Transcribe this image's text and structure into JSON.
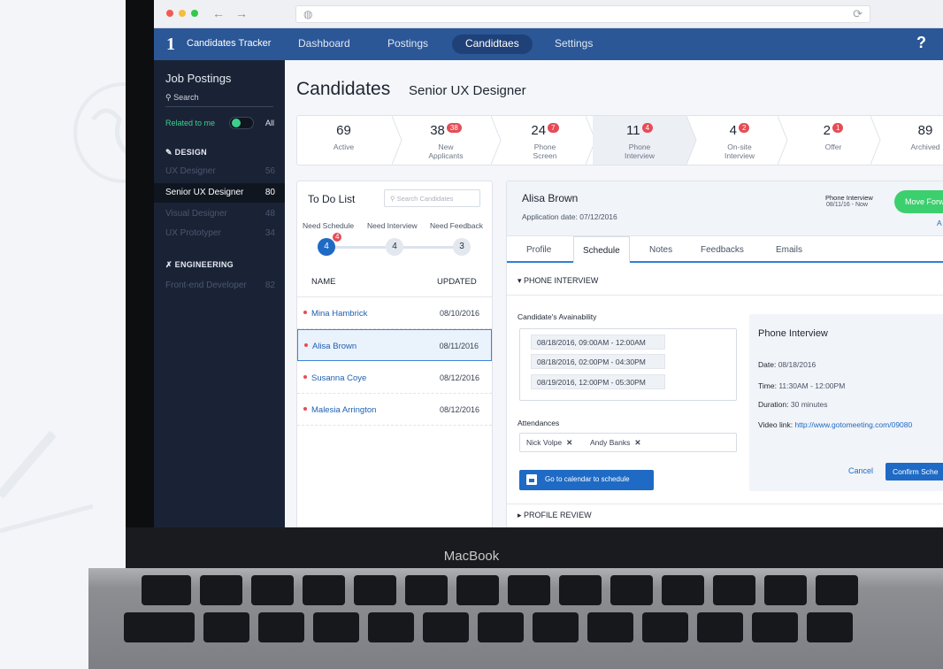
{
  "device": {
    "brand": "MacBook"
  },
  "browser": {
    "url": "",
    "nav_back": "←",
    "nav_forward": "→",
    "reload_glyph": "⟳",
    "globe_glyph": "◍"
  },
  "app": {
    "logo": "1",
    "title": "Candidates Tracker",
    "help": "?"
  },
  "topnav": {
    "items": [
      "Dashboard",
      "Postings",
      "Candidtaes",
      "Settings"
    ],
    "active": "Candidtaes"
  },
  "sidebar": {
    "title": "Job Postings",
    "search_placeholder": "Search",
    "related_label": "Related to me",
    "all_label": "All",
    "sections": [
      {
        "name": "DESIGN",
        "icon": "tools-icon",
        "items": [
          {
            "label": "UX Designer",
            "count": "56"
          },
          {
            "label": "Senior UX Designer",
            "count": "80",
            "active": true
          },
          {
            "label": "Visual Designer",
            "count": "48"
          },
          {
            "label": "UX Prototyper",
            "count": "34"
          }
        ]
      },
      {
        "name": "ENGINEERING",
        "icon": "engineering-icon",
        "items": [
          {
            "label": "Front-end Developer",
            "count": "82"
          }
        ]
      }
    ]
  },
  "page": {
    "title": "Candidates",
    "subtitle": "Senior UX Designer"
  },
  "pipeline": [
    {
      "count": "69",
      "label": "Active",
      "badge": ""
    },
    {
      "count": "38",
      "label": "New Applicants",
      "badge": "38"
    },
    {
      "count": "24",
      "label": "Phone Screen",
      "badge": "7"
    },
    {
      "count": "11",
      "label": "Phone Interview",
      "badge": "4"
    },
    {
      "count": "4",
      "label": "On-site Interview",
      "badge": "2"
    },
    {
      "count": "2",
      "label": "Offer",
      "badge": "1"
    },
    {
      "count": "89",
      "label": "Archived",
      "badge": ""
    }
  ],
  "todo": {
    "title": "To Do List",
    "search_placeholder": "Search Candidates",
    "steps": [
      {
        "label": "Need Schedule",
        "count": "4",
        "badge": "4"
      },
      {
        "label": "Need Interview",
        "count": "4"
      },
      {
        "label": "Need Feedback",
        "count": "3"
      }
    ],
    "columns": {
      "name": "NAME",
      "updated": "UPDATED"
    },
    "rows": [
      {
        "name": "Mina Hambrick",
        "updated": "08/10/2016"
      },
      {
        "name": "Alisa Brown",
        "updated": "08/11/2016",
        "selected": true
      },
      {
        "name": "Susanna Coye",
        "updated": "08/12/2016"
      },
      {
        "name": "Malesia Arrington",
        "updated": "08/12/2016"
      }
    ]
  },
  "detail": {
    "name": "Alisa Brown",
    "application_date": "Application date:  07/12/2016",
    "stage": "Phone Interview",
    "stage_date": "08/11/16 - Now",
    "move_button": "Move Forw",
    "side_link": "A",
    "tabs": [
      "Profile",
      "Schedule",
      "Notes",
      "Feedbacks",
      "Emails"
    ],
    "active_tab": "Schedule",
    "section_phone": "PHONE INTERVIEW",
    "availability_label": "Candidate's Avainability",
    "slots": [
      "08/18/2016, 09:00AM - 12:00AM",
      "08/18/2016, 02:00PM - 04:30PM",
      "08/19/2016, 12:00PM - 05:30PM"
    ],
    "attendances_label": "Attendances",
    "attendees": [
      "Nick Volpe",
      "Andy Banks"
    ],
    "remove_glyph": "✕",
    "calendar_button": "Go to calendar to schedule",
    "section_profile": "PROFILE REVIEW",
    "interview": {
      "title": "Phone Interview",
      "date_label": "Date:",
      "date": "08/18/2016",
      "time_label": "Time:",
      "time": "11:30AM - 12:00PM",
      "duration_label": "Duration:",
      "duration": "30 minutes",
      "video_label": "Video link:",
      "video": "http://www.gotomeeting.com/09080",
      "cancel": "Cancel",
      "confirm": "Confirm Sche"
    }
  },
  "colors": {
    "nav": "#2b5797",
    "sidebar": "#1a2336",
    "accent": "#1e6ac4",
    "badge": "#e44d56",
    "success": "#3ccf6e"
  }
}
